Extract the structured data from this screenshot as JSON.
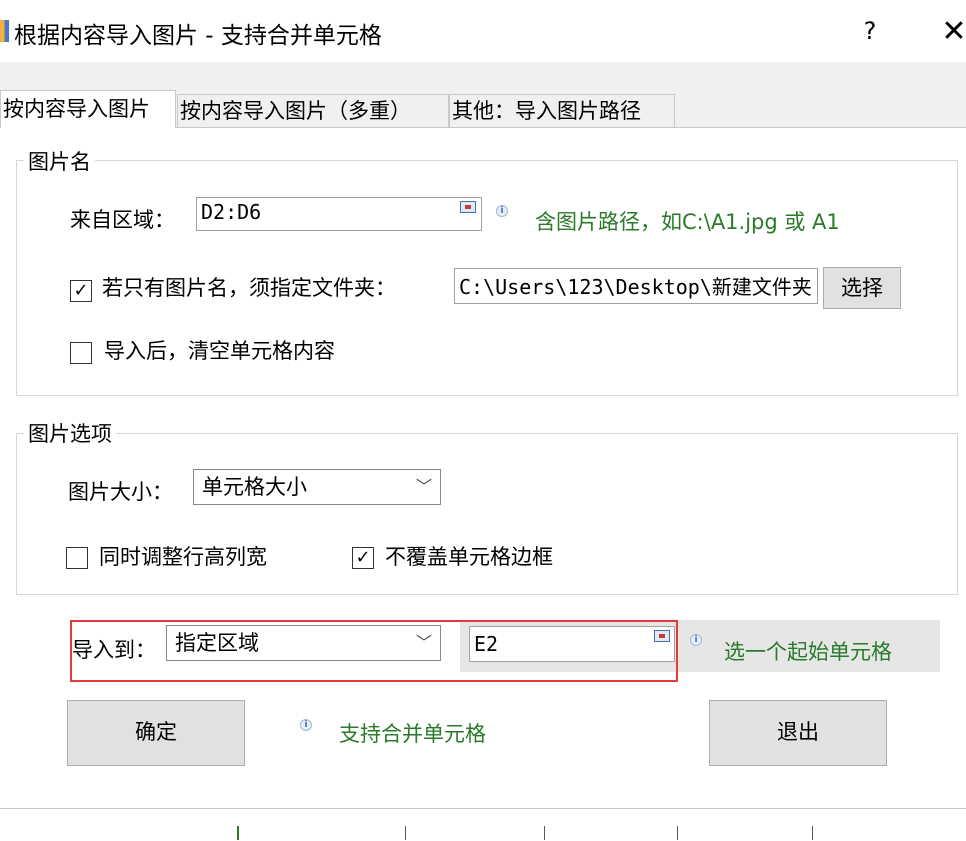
{
  "window": {
    "title": "根据内容导入图片 - 支持合并单元格",
    "help_label": "?",
    "close_label": "✕"
  },
  "tabs": [
    {
      "label": "按内容导入图片",
      "active": true
    },
    {
      "label": "按内容导入图片（多重）",
      "active": false
    },
    {
      "label": "其他：导入图片路径",
      "active": false
    }
  ],
  "picture_name_group": {
    "title": "图片名",
    "source_label": "来自区域：",
    "source_value": "D2:D6",
    "source_hint": "含图片路径，如C:\\A1.jpg 或 A1",
    "folder_checkbox_label": "若只有图片名，须指定文件夹：",
    "folder_checked": true,
    "folder_value": "C:\\Users\\123\\Desktop\\新建文件夹",
    "choose_button": "选择",
    "clear_checkbox_label": "导入后，清空单元格内容",
    "clear_checked": false
  },
  "picture_options_group": {
    "title": "图片选项",
    "size_label": "图片大小：",
    "size_value": "单元格大小",
    "adjust_checkbox_label": "同时调整行高列宽",
    "adjust_checked": false,
    "nooverlap_checkbox_label": "不覆盖单元格边框",
    "nooverlap_checked": true
  },
  "import_to": {
    "label": "导入到：",
    "mode_value": "指定区域",
    "cell_value": "E2",
    "hint": "选一个起始单元格"
  },
  "footer": {
    "ok_button": "确定",
    "merge_hint": "支持合并单元格",
    "exit_button": "退出"
  },
  "colors": {
    "hint_green": "#2a7a2a",
    "highlight_red": "#e33a3a"
  }
}
